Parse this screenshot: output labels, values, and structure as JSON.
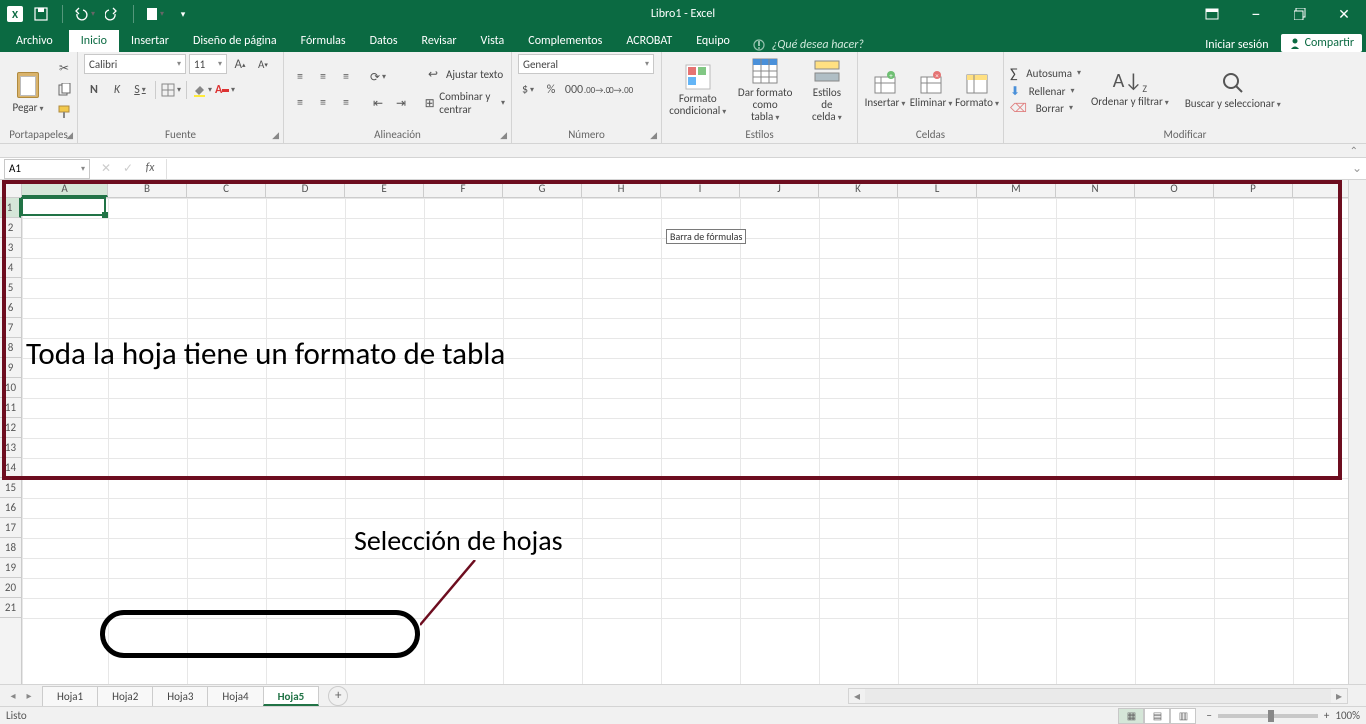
{
  "title": "Libro1 - Excel",
  "qat": {
    "save": "save",
    "undo": "undo",
    "redo": "redo",
    "newfile": "new"
  },
  "window": {
    "ribbon_options": "⋯",
    "min": "−",
    "restore": "❐",
    "close": "✕"
  },
  "tabs": {
    "archivo": "Archivo",
    "inicio": "Inicio",
    "insertar": "Insertar",
    "diseno": "Diseño de página",
    "formulas": "Fórmulas",
    "datos": "Datos",
    "revisar": "Revisar",
    "vista": "Vista",
    "complementos": "Complementos",
    "acrobat": "ACROBAT",
    "equipo": "Equipo"
  },
  "tellme_placeholder": "¿Qué desea hacer?",
  "signin": "Iniciar sesión",
  "share": "Compartir",
  "ribbon": {
    "portapapeles": {
      "label": "Portapapeles",
      "pegar": "Pegar"
    },
    "fuente": {
      "label": "Fuente",
      "name": "Calibri",
      "size": "11",
      "bold": "N",
      "italic": "K",
      "underline": "S"
    },
    "alineacion": {
      "label": "Alineación",
      "wrap": "Ajustar texto",
      "merge": "Combinar y centrar"
    },
    "numero": {
      "label": "Número",
      "format": "General"
    },
    "estilos": {
      "label": "Estilos",
      "cond": "Formato condicional",
      "table": "Dar formato como tabla",
      "cell": "Estilos de celda"
    },
    "celdas": {
      "label": "Celdas",
      "insert": "Insertar",
      "delete": "Eliminar",
      "format": "Formato"
    },
    "modificar": {
      "label": "Modificar",
      "autosum": "Autosuma",
      "fill": "Rellenar",
      "clear": "Borrar",
      "sort": "Ordenar y filtrar",
      "find": "Buscar y seleccionar"
    }
  },
  "namebox": "A1",
  "formula_bar_tooltip": "Barra de fórmulas",
  "columns": [
    "A",
    "B",
    "C",
    "D",
    "E",
    "F",
    "G",
    "H",
    "I",
    "J",
    "K",
    "L",
    "M",
    "N",
    "O",
    "P"
  ],
  "rows": [
    1,
    2,
    3,
    4,
    5,
    6,
    7,
    8,
    9,
    10,
    11,
    12,
    13,
    14,
    15,
    16,
    17,
    18,
    19,
    20,
    21
  ],
  "col_widths": {
    "first": 86,
    "rest": 79
  },
  "active_cell": "A1",
  "sheet_tabs": [
    "Hoja1",
    "Hoja2",
    "Hoja3",
    "Hoja4",
    "Hoja5"
  ],
  "active_sheet_index": 4,
  "status": {
    "ready": "Listo",
    "zoom": "100%"
  },
  "annot": {
    "table_text": "Toda la hoja tiene un formato de tabla",
    "sheets_text": "Selección de hojas"
  }
}
